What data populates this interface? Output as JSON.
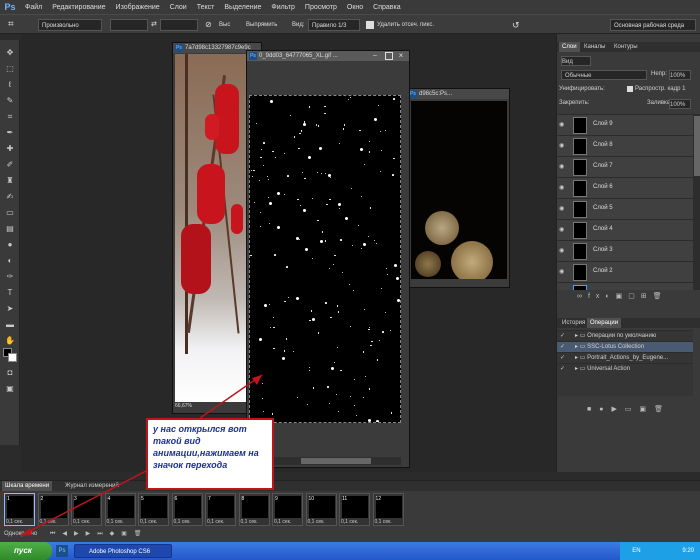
{
  "menu": {
    "logo": "Ps",
    "items": [
      "Файл",
      "Редактирование",
      "Изображение",
      "Слои",
      "Текст",
      "Выделение",
      "Фильтр",
      "Просмотр",
      "Окно",
      "Справка"
    ]
  },
  "options_bar": {
    "style_value": "Произвольно",
    "swap_symbol": "⇄",
    "height_label": "Выс",
    "align_label": "Выпрямить",
    "view_label": "Вид:",
    "view_value": "Правило 1/3",
    "delete_crop_label": "Удалить отсеч. пикс.",
    "workspace_value": "Основная рабочая среда"
  },
  "docs": {
    "doc1_title": "7a7d98c13327987c9e9c",
    "doc1_zoom": "66,67%",
    "doc2_title": "0_9dd03_64777065_XL.gif ...",
    "doc3_title": "d98c5c:Ps..."
  },
  "layers_panel": {
    "tabs": [
      "Слои",
      "Каналы",
      "Контуры"
    ],
    "kind_label": "Вид",
    "blend_mode": "Обычные",
    "opacity_label": "Непр:",
    "opacity_value": "100%",
    "unify_label": "Унифицировать:",
    "propagate_label": "Распростр. кадр 1",
    "lock_label": "Закрепить:",
    "fill_label": "Заливка:",
    "fill_value": "100%",
    "layers": [
      "Слой 9",
      "Слой 8",
      "Слой 7",
      "Слой 6",
      "Слой 5",
      "Слой 4",
      "Слой 3",
      "Слой 2"
    ]
  },
  "actions_panel": {
    "tabs": [
      "История",
      "Операции"
    ],
    "rows": [
      "Операции по умолчанию",
      "SSC-Lotus Collection",
      "Portrait_Actions_by_Eugene...",
      "Universal Action"
    ]
  },
  "timeline": {
    "tabs": [
      "Шкала времени",
      "Журнал измерений"
    ],
    "loop_value": "Однократно",
    "frames": [
      {
        "num": "1",
        "delay": "0,1 сек."
      },
      {
        "num": "2",
        "delay": "0,1 сек."
      },
      {
        "num": "3",
        "delay": "0,1 сек."
      },
      {
        "num": "4",
        "delay": "0,1 сек."
      },
      {
        "num": "5",
        "delay": "0,1 сек."
      },
      {
        "num": "6",
        "delay": "0,1 сек."
      },
      {
        "num": "7",
        "delay": "0,1 сек."
      },
      {
        "num": "8",
        "delay": "0,1 сек."
      },
      {
        "num": "9",
        "delay": "0,1 сек."
      },
      {
        "num": "10",
        "delay": "0,1 сек."
      },
      {
        "num": "11",
        "delay": "0,1 сек."
      },
      {
        "num": "12",
        "delay": "0,1 сек."
      }
    ]
  },
  "callout": {
    "text": "у нас открылся вот такой вид анимации,нажимаем на значок перехода"
  },
  "taskbar": {
    "start_label": "пуск",
    "task_label": "Adobe Photoshop CS6",
    "lang": "EN",
    "time": "9:20"
  },
  "colors": {
    "callout_border": "#c0141c",
    "callout_text": "#1d2f9c",
    "berries": "#c8141c",
    "taskbar": "#2458c9"
  }
}
